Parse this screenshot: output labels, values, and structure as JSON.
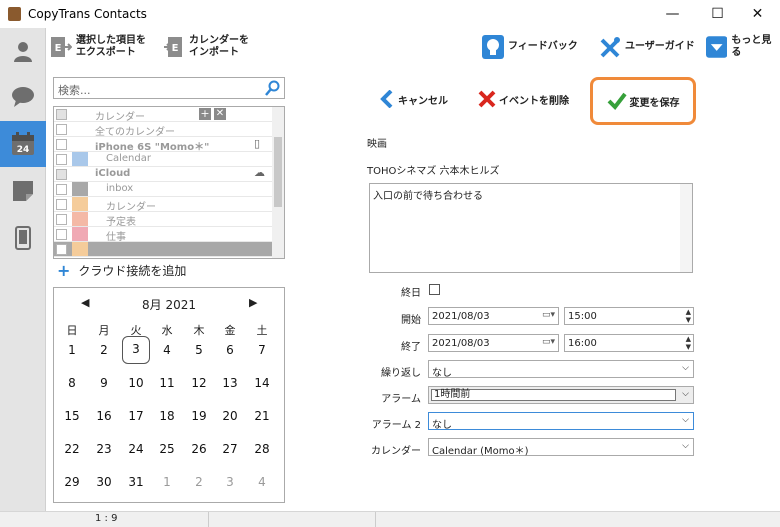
{
  "window": {
    "title": "CopyTrans Contacts",
    "minimize": "—",
    "maximize": "☐",
    "close": "✕"
  },
  "toolbar": {
    "export_label": "選択した項目を\nエクスポート",
    "import_label": "カレンダーを\nインポート",
    "feedback_label": "フィードバック",
    "guide_label": "ユーザーガイド",
    "more_label": "もっと見る"
  },
  "search": {
    "placeholder": "検索..."
  },
  "calendar_list": [
    {
      "label": "カレンダー",
      "color": "",
      "indent": false,
      "bold": false
    },
    {
      "label": "全てのカレンダー",
      "color": "",
      "indent": false,
      "bold": false
    },
    {
      "label": "iPhone 6S \"Momo＊\"",
      "color": "",
      "indent": false,
      "bold": true
    },
    {
      "label": "Calendar",
      "color": "#a9c8ea",
      "indent": true,
      "bold": false
    },
    {
      "label": "iCloud",
      "color": "",
      "indent": false,
      "bold": true
    },
    {
      "label": "inbox",
      "color": "#a8a8a8",
      "indent": true,
      "bold": false
    },
    {
      "label": "カレンダー",
      "color": "#f5cc9a",
      "indent": true,
      "bold": false
    },
    {
      "label": "予定表",
      "color": "#f4b9a6",
      "indent": true,
      "bold": false
    },
    {
      "label": "仕事",
      "color": "#f0a9b4",
      "indent": true,
      "bold": false
    },
    {
      "label": "",
      "color": "#f5cc9a",
      "indent": true,
      "bold": false
    }
  ],
  "add_cloud_label": "クラウド接続を追加",
  "mini_calendar": {
    "month_label": "8月 2021",
    "weekdays": [
      "日",
      "月",
      "火",
      "水",
      "木",
      "金",
      "土"
    ],
    "weeks": [
      [
        "1",
        "2",
        "3",
        "4",
        "5",
        "6",
        "7"
      ],
      [
        "8",
        "9",
        "10",
        "11",
        "12",
        "13",
        "14"
      ],
      [
        "15",
        "16",
        "17",
        "18",
        "19",
        "20",
        "21"
      ],
      [
        "22",
        "23",
        "24",
        "25",
        "26",
        "27",
        "28"
      ],
      [
        "29",
        "30",
        "31",
        "1",
        "2",
        "3",
        "4"
      ]
    ],
    "selected_day": "3"
  },
  "actions": {
    "cancel_label": "キャンセル",
    "delete_label": "イベントを削除",
    "save_label": "変更を保存"
  },
  "event": {
    "title": "映画",
    "location": "TOHOシネマズ 六本木ヒルズ",
    "notes": "入口の前で待ち合わせる",
    "allday_label": "終日",
    "start_label": "開始",
    "start_date": "2021/08/03",
    "start_time": "15:00",
    "end_label": "終了",
    "end_date": "2021/08/03",
    "end_time": "16:00",
    "repeat_label": "繰り返し",
    "repeat_value": "なし",
    "alarm_label": "アラーム",
    "alarm_value": "1時間前",
    "alarm2_label": "アラーム 2",
    "alarm2_value": "なし",
    "calendar_label": "カレンダー",
    "calendar_value": "Calendar (Momo＊)"
  },
  "status_text": "1 : 9",
  "colors": {
    "accent": "#3d8bd9",
    "save_highlight": "#f08a3a"
  }
}
